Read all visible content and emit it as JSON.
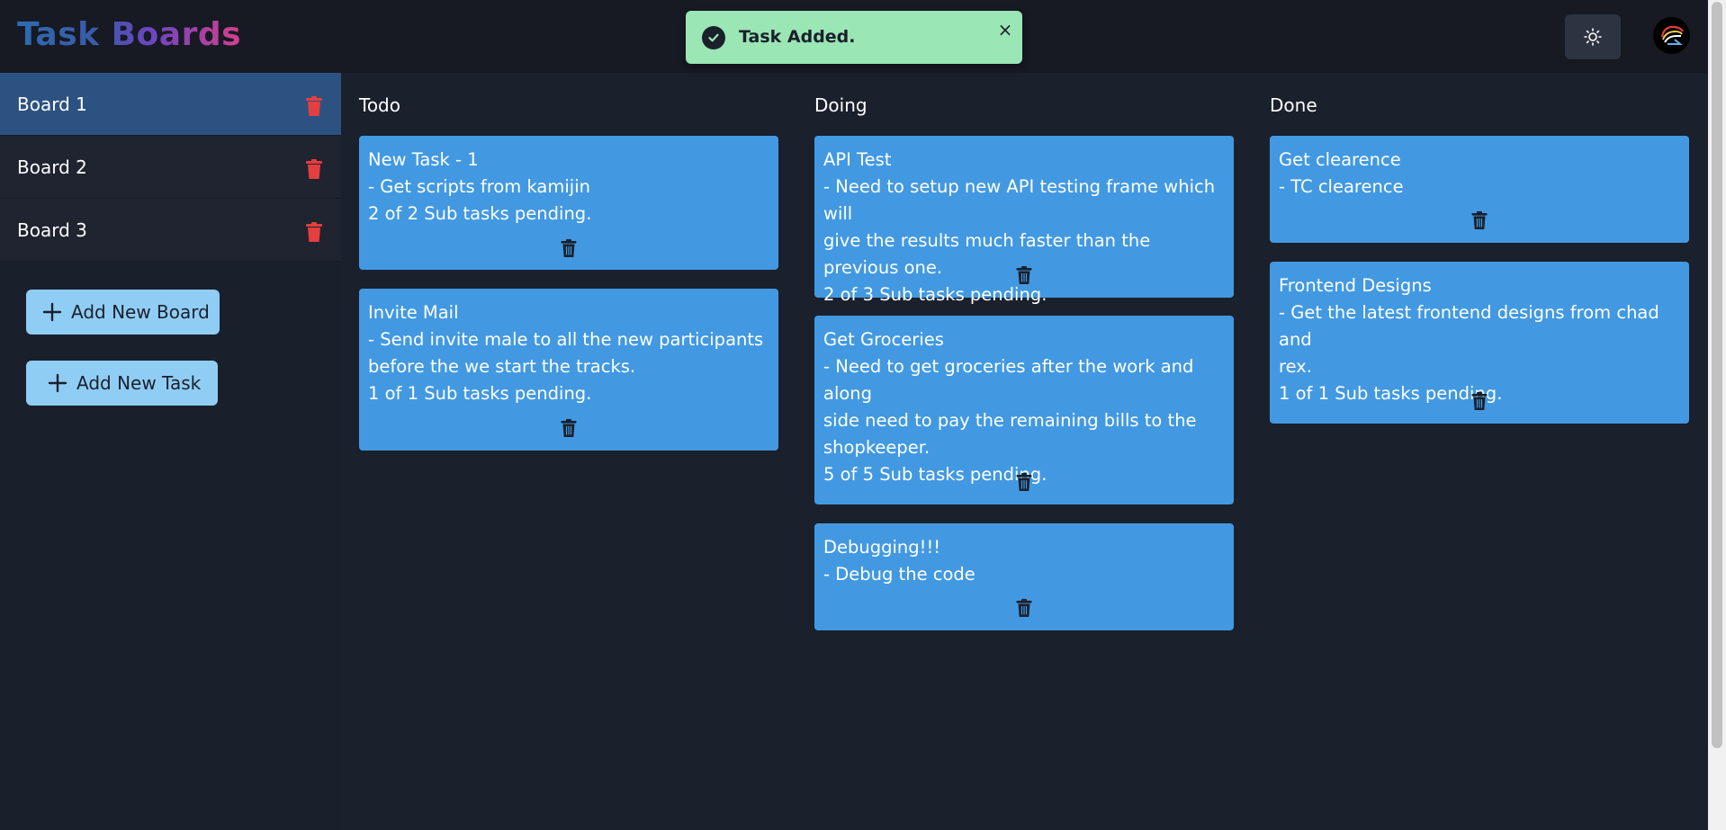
{
  "app": {
    "title": "Task Boards"
  },
  "toast": {
    "message": "Task Added.",
    "close": "×"
  },
  "colors": {
    "accent": "#4299e1",
    "active_board": "#2c5282",
    "button": "#90cdf4",
    "delete": "#e53e3e",
    "toast": "#9ae6b4"
  },
  "sidebar": {
    "boards": [
      {
        "label": "Board 1",
        "active": true
      },
      {
        "label": "Board 2",
        "active": false
      },
      {
        "label": "Board 3",
        "active": false
      }
    ],
    "add_board_label": "Add New Board",
    "add_task_label": "Add New Task"
  },
  "columns": [
    {
      "title": "Todo",
      "cards": [
        {
          "title": "New Task - 1",
          "lines": [
            "- Get scripts from kamijin"
          ],
          "status": "2 of 2 Sub tasks pending."
        },
        {
          "title": "Invite Mail",
          "lines": [
            "- Send invite male to all the new participants",
            "before the we start the tracks."
          ],
          "status": "1 of 1 Sub tasks pending."
        }
      ]
    },
    {
      "title": "Doing",
      "cards": [
        {
          "title": "API Test",
          "lines": [
            "- Need to setup new API testing frame which will",
            "give the results much faster than the previous one."
          ],
          "status": "2 of 3 Sub tasks pending."
        },
        {
          "title": "Get Groceries",
          "lines": [
            "- Need to get groceries after the work and along",
            "side need to pay the remaining bills to the",
            "shopkeeper."
          ],
          "status": "5 of 5 Sub tasks pending."
        },
        {
          "title": "Debugging!!!",
          "lines": [
            "- Debug the code"
          ],
          "status": ""
        }
      ]
    },
    {
      "title": "Done",
      "cards": [
        {
          "title": "Get clearence",
          "lines": [
            "- TC clearence"
          ],
          "status": ""
        },
        {
          "title": "Frontend Designs",
          "lines": [
            "- Get the latest frontend designs from chad and",
            "rex."
          ],
          "status": "1 of 1 Sub tasks pending."
        }
      ]
    }
  ]
}
